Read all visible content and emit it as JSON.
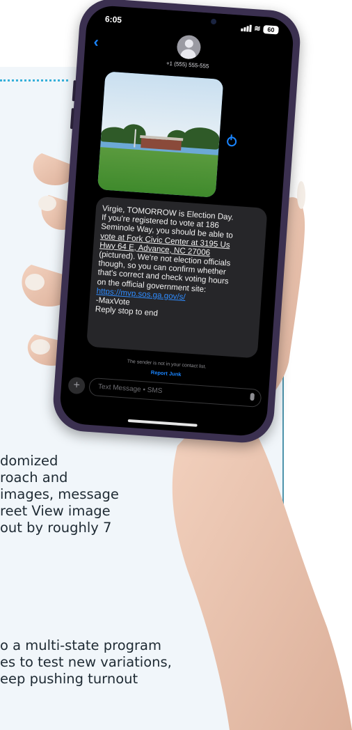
{
  "article": {
    "para1": [
      "domized",
      "roach and",
      "images, message",
      "reet View image",
      "out by roughly 7"
    ],
    "para2": [
      "o a multi-state program",
      "es to test new variations,",
      "eep pushing turnout"
    ]
  },
  "phone": {
    "status": {
      "time": "6:05",
      "battery": "60"
    },
    "contact": {
      "number": "+1 (555) 555-555"
    },
    "message_lines": [
      "Virgie, TOMORROW is Election Day.",
      "If you're registered to vote at 186",
      "Seminole Way, you should be able to",
      "vote at Fork Civic Center at 3195 Us",
      "Hwy 64 E, Advance, NC 27006",
      "(pictured). We're not election officials",
      "though, so you can confirm whether",
      "that's correct and check voting hours",
      "on the official government site:",
      "https://mvp.sos.ga.gov/s/",
      "-MaxVote",
      "Reply stop to end"
    ],
    "sender_notice": "The sender is not in your contact list.",
    "report_junk": "Report Junk",
    "composer_placeholder": "Text Message • SMS",
    "icons": {
      "back": "chevron-left-icon",
      "share": "share-icon",
      "plus": "plus-icon",
      "mic": "microphone-icon"
    }
  },
  "colors": {
    "card_bg": "#f1f6fa",
    "card_border": "#4c93ab",
    "dotted": "#36b0d9",
    "ios_blue": "#1a85ff",
    "bubble": "#262629"
  }
}
